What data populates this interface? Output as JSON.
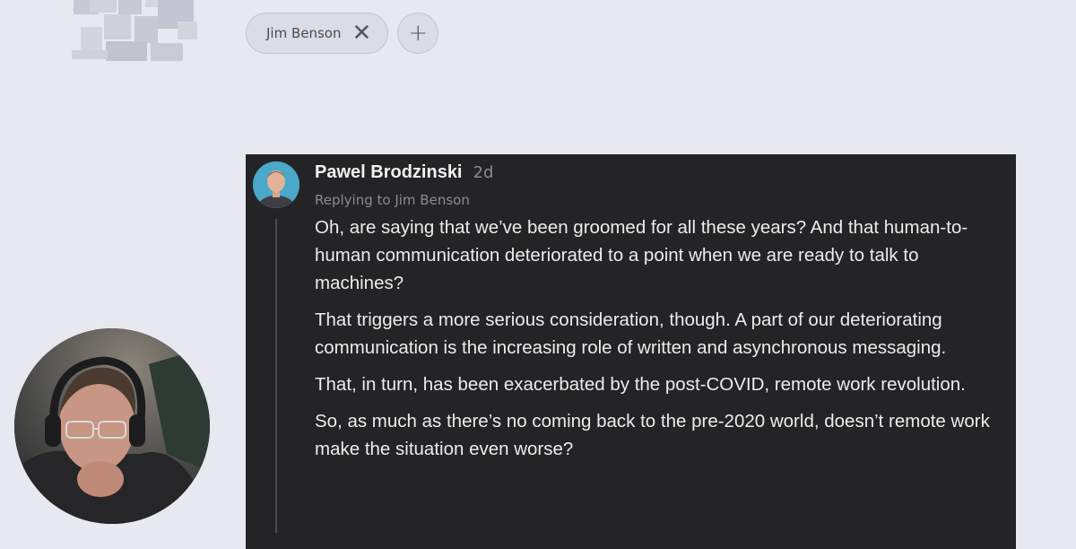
{
  "filter_chips": [
    {
      "label": "Jim Benson",
      "remove_icon": "close-icon"
    }
  ],
  "add_filter_icon": "plus-icon",
  "comment": {
    "author": "Pawel Brodzinski",
    "age": "2d",
    "replying_to": "Replying to Jim Benson",
    "paragraphs": [
      "Oh, are saying that we’ve been groomed for all these years? And that human-to-human communication deteriorated to a point when we are ready to talk to machines?",
      "That triggers a more serious consideration, though. A part of our deteriorating communication is the increasing role of written and asynchronous messaging.",
      "That, in turn, has been exacerbated by the post-COVID, remote work revolution.",
      "So, as much as there’s no coming back to the pre-2020 world, doesn’t remote work make the situation even worse?"
    ]
  },
  "colors": {
    "page_bg": "#e8e8f1",
    "card_bg": "#242426",
    "avatar_bg": "#4aa8c8"
  }
}
